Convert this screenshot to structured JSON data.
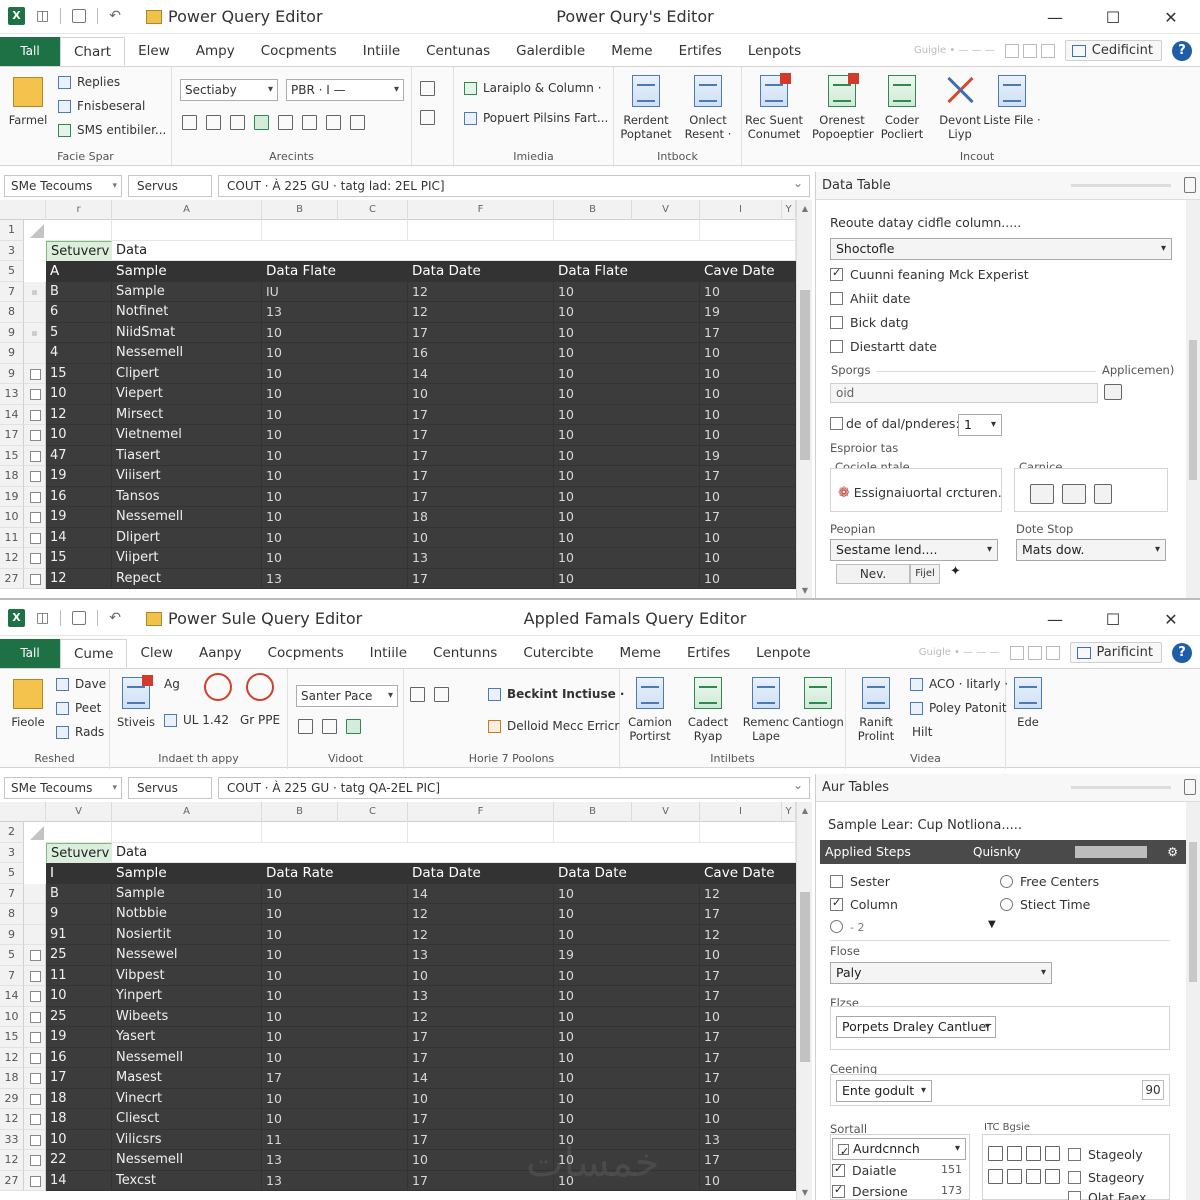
{
  "win1": {
    "doc_title": "Power Query Editor",
    "center_title": "Power Qury's Editor",
    "file_tab": "Tall",
    "menu": [
      "Chart",
      "Elew",
      "Ampy",
      "Cocpments",
      "Intiile",
      "Centunas",
      "Galerdible",
      "Meme",
      "Ertifes",
      "Lenpots"
    ],
    "menu_hint": "Guigle • — — —",
    "account": "Cedificint",
    "ribbon": {
      "g1": {
        "big": "Farmel",
        "items": [
          "Replies",
          "Fnisbeseral",
          "SMS entibiler..."
        ],
        "label": "Facie Spar"
      },
      "g2": {
        "dd1": "Sectiaby",
        "dd2": "PBR",
        "dd2b": "· I —",
        "label": "Arecints"
      },
      "g3": {
        "items": [
          "Laraiplo & Column ·",
          "Popuert Pilsins Fart..."
        ],
        "label": "Imiedia"
      },
      "g4": {
        "b1": "Rerdent Poptanet",
        "b2": "Onlect Resent ·",
        "label": "Intbock"
      },
      "g5": {
        "b1": "Rec Suent Conumet",
        "b2": "Orenest Popoeptier",
        "b3": "Coder Pocliert",
        "b4": "Devont Liyp",
        "b5": "Liste File ·",
        "label": "Incout"
      }
    },
    "formula": {
      "name_box": "SMe Tecoums",
      "fx_text": "Servus",
      "input": "COUT · À 225 GU  · tatg lad: 2EL PIC]"
    },
    "col_headers": [
      "r",
      "A",
      "B",
      "C",
      "F",
      "B",
      "V",
      "I",
      "Y"
    ],
    "label_row": {
      "num": "3",
      "left": "Setuverv",
      "right": "Data"
    },
    "header_row": {
      "num": "5",
      "cells": [
        "A",
        "Sample",
        "Data Flate",
        "Data Date",
        "Data Flate",
        "Cave Date"
      ]
    },
    "rows": [
      {
        "n": "7",
        "m": "dot",
        "c": [
          "B",
          "Sample",
          "IU",
          "12",
          "10",
          "10"
        ]
      },
      {
        "n": "8",
        "m": "none",
        "c": [
          "6",
          "Notfinet",
          "13",
          "12",
          "10",
          "19"
        ]
      },
      {
        "n": "9",
        "m": "dot",
        "c": [
          "5",
          "NiidSmat",
          "10",
          "17",
          "10",
          "17"
        ]
      },
      {
        "n": "9",
        "m": "none",
        "c": [
          "4",
          "Nessemell",
          "10",
          "16",
          "10",
          "10"
        ]
      },
      {
        "n": "9",
        "m": "box",
        "c": [
          "15",
          "Clipert",
          "10",
          "14",
          "10",
          "10"
        ]
      },
      {
        "n": "13",
        "m": "box",
        "c": [
          "10",
          "Viepert",
          "10",
          "10",
          "10",
          "10"
        ]
      },
      {
        "n": "14",
        "m": "box",
        "c": [
          "12",
          "Mirsect",
          "10",
          "17",
          "10",
          "10"
        ]
      },
      {
        "n": "17",
        "m": "box",
        "c": [
          "10",
          "Vietnemel",
          "10",
          "17",
          "10",
          "10"
        ]
      },
      {
        "n": "15",
        "m": "box",
        "c": [
          "47",
          "Tiasert",
          "10",
          "17",
          "10",
          "19"
        ]
      },
      {
        "n": "18",
        "m": "box",
        "c": [
          "19",
          "Viiisert",
          "10",
          "17",
          "10",
          "17"
        ]
      },
      {
        "n": "19",
        "m": "box",
        "c": [
          "16",
          "Tansos",
          "10",
          "17",
          "10",
          "10"
        ]
      },
      {
        "n": "10",
        "m": "box",
        "c": [
          "19",
          "Nessemell",
          "10",
          "18",
          "10",
          "17"
        ]
      },
      {
        "n": "11",
        "m": "box",
        "c": [
          "14",
          "Dlipert",
          "10",
          "10",
          "10",
          "10"
        ]
      },
      {
        "n": "12",
        "m": "box",
        "c": [
          "15",
          "Viipert",
          "10",
          "13",
          "10",
          "10"
        ]
      },
      {
        "n": "27",
        "m": "box",
        "c": [
          "12",
          "Repect",
          "13",
          "17",
          "10",
          "10"
        ]
      }
    ],
    "panel": {
      "title": "Data Table",
      "q": "Reoute datay cidfle column.....",
      "dd1": "Shoctofle",
      "checks": [
        {
          "label": "Cuunni feaning Mck Experist",
          "on": true
        },
        {
          "label": "Ahiit date",
          "on": false
        },
        {
          "label": "Bick datg",
          "on": false
        },
        {
          "label": "Diestartt date",
          "on": false
        }
      ],
      "sporgs": "Sporgs",
      "applic": "Applicemen)",
      "input_val": "oid",
      "mode_label": "de of dal/pnderes:",
      "mode_val": "1",
      "espr": "Esproior tas",
      "box1_title": "Cociole ntale",
      "box1_text": "Essignaiuortal crcturen.",
      "box2_title": "Carnice",
      "l1": "Peopian",
      "l2": "Dote Stop",
      "dd2": "Sestame lend....",
      "dd3": "Mats dow.",
      "btn1": "Nev.",
      "btn2": "Fijel"
    }
  },
  "win2": {
    "doc_title": "Power Sule Query Editor",
    "center_title": "Appled Famals Query Editor",
    "file_tab": "Tall",
    "menu": [
      "Cume",
      "Clew",
      "Aanpy",
      "Cocpments",
      "Intiile",
      "Centunns",
      "Cutercibte",
      "Meme",
      "Ertifes",
      "Lenpote"
    ],
    "menu_hint": "Guigle • — — —",
    "account": "Parificint",
    "ribbon": {
      "g1": {
        "big": "Fieole",
        "items": [
          "Dave",
          "Peet",
          "Rads"
        ],
        "label": "Reshed"
      },
      "g2": {
        "big": "Stiveis",
        "items": [
          "Ag",
          "UL 1.42",
          "Gr PPE"
        ],
        "label": "Indaet th appy"
      },
      "g3": {
        "dd": "Santer Pace",
        "label": "Vidoot"
      },
      "g4": {
        "items": [
          "Beckint Inctiuse ·",
          "Delloid Mecc Erricr"
        ],
        "label": "Horie 7 Poolons"
      },
      "g5": {
        "b1": "Camion Portirst",
        "b2": "Cadect Ryap",
        "b3": "Remenc Lape",
        "b4": "Cantiogn",
        "label": "Intilbets"
      },
      "g6": {
        "b1": "Ranift Prolint",
        "items": [
          "ACO · Iitarly ·",
          "Poley Patonit",
          "Hilt"
        ],
        "label": "Videa"
      },
      "g7": {
        "b1": "Ede"
      }
    },
    "formula": {
      "name_box": "SMe Tecoums",
      "fx_text": "Servus",
      "input": "COUT · À 225 GU  · tatg QA-2EL PIC]"
    },
    "col_headers": [
      "V",
      "A",
      "B",
      "C",
      "F",
      "B",
      "V",
      "I",
      "Y"
    ],
    "label_row": {
      "num": "3",
      "left": "Setuverv",
      "right": "Data"
    },
    "header_row": {
      "num": "5",
      "cells": [
        "I",
        "Sample",
        "Data Rate",
        "Data Date",
        "Data Date",
        "Cave Date"
      ]
    },
    "rows": [
      {
        "n": "7",
        "m": "none",
        "c": [
          "B",
          "Sample",
          "10",
          "14",
          "10",
          "12"
        ]
      },
      {
        "n": "8",
        "m": "none",
        "c": [
          "9",
          "Notbbie",
          "10",
          "12",
          "10",
          "17"
        ]
      },
      {
        "n": "9",
        "m": "none",
        "c": [
          "91",
          "Nosiertit",
          "10",
          "12",
          "10",
          "12"
        ]
      },
      {
        "n": "5",
        "m": "box",
        "c": [
          "25",
          "Nessewel",
          "10",
          "13",
          "19",
          "10"
        ]
      },
      {
        "n": "7",
        "m": "box",
        "c": [
          "11",
          "Vibpest",
          "10",
          "10",
          "10",
          "17"
        ]
      },
      {
        "n": "14",
        "m": "box",
        "c": [
          "10",
          "Yinpert",
          "10",
          "13",
          "10",
          "17"
        ]
      },
      {
        "n": "10",
        "m": "box",
        "c": [
          "25",
          "Wibeets",
          "10",
          "12",
          "10",
          "10"
        ]
      },
      {
        "n": "15",
        "m": "box",
        "c": [
          "19",
          "Yasert",
          "10",
          "17",
          "10",
          "17"
        ]
      },
      {
        "n": "12",
        "m": "box",
        "c": [
          "16",
          "Nessemell",
          "10",
          "17",
          "10",
          "17"
        ]
      },
      {
        "n": "18",
        "m": "box",
        "c": [
          "17",
          "Masest",
          "17",
          "14",
          "10",
          "17"
        ]
      },
      {
        "n": "29",
        "m": "box",
        "c": [
          "18",
          "Vinecrt",
          "10",
          "10",
          "10",
          "10"
        ]
      },
      {
        "n": "12",
        "m": "box",
        "c": [
          "18",
          "Cliesct",
          "10",
          "17",
          "10",
          "10"
        ]
      },
      {
        "n": "33",
        "m": "box",
        "c": [
          "10",
          "Vilicsrs",
          "11",
          "17",
          "10",
          "13"
        ]
      },
      {
        "n": "12",
        "m": "box",
        "c": [
          "22",
          "Nessemell",
          "13",
          "10",
          "10",
          "17"
        ]
      },
      {
        "n": "27",
        "m": "box",
        "c": [
          "14",
          "Texcst",
          "13",
          "17",
          "10",
          "10"
        ]
      }
    ],
    "panel": {
      "title": "Aur Tables",
      "q": "Sample Lear: Cup Notliona.....",
      "steps_label": "Applied Steps",
      "steps_right": "Quisnky",
      "opts_left": [
        "Sester",
        "Column",
        "- 2"
      ],
      "opts_right": [
        "Free Centers",
        "Stiect Time"
      ],
      "l1": "Flose",
      "dd1": "Paly",
      "l2": "Flzse",
      "dd2": "Porpets Draley Cantluer",
      "l3": "Ceening",
      "dd3": "Ente godult",
      "num_val": "90",
      "l4": "Sortall",
      "l5": "ITC Bgsie",
      "list_left": [
        {
          "label": "Aurdcnnch",
          "val": ""
        },
        {
          "label": "Daiatle",
          "val": "151"
        },
        {
          "label": "Dersione",
          "val": "173"
        }
      ],
      "list_right": [
        "Stageoly",
        "Stageory",
        "Olat Faex"
      ]
    }
  },
  "watermark": "خمسات"
}
